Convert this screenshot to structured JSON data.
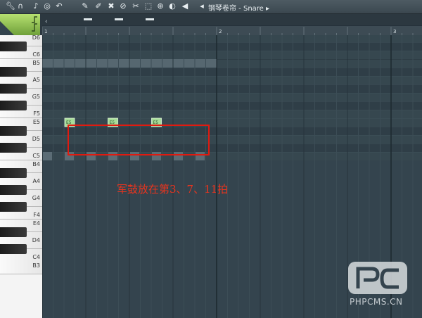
{
  "toolbar": {
    "icons": [
      "wrench-icon",
      "magnet-icon",
      "note-icon",
      "record-icon",
      "undo-icon",
      "pencil-icon",
      "brush-icon",
      "delete-icon",
      "mute-icon",
      "slice-icon",
      "select-icon",
      "zoom-icon",
      "playback-icon",
      "speaker-icon"
    ],
    "title": "钢琴卷帘 - Snare",
    "title_arrow": "▸"
  },
  "ruler": {
    "bar_numbers": [
      "1",
      "2",
      "3"
    ]
  },
  "keyboard": {
    "labels": [
      "D6",
      "C6",
      "B5",
      "A5",
      "G5",
      "F5",
      "E5",
      "D5",
      "C5",
      "B4",
      "A4",
      "G4",
      "F4",
      "E4",
      "D4",
      "C4",
      "B3"
    ]
  },
  "notes": [
    {
      "label": "E5",
      "beat": 3
    },
    {
      "label": "E5",
      "beat": 7
    },
    {
      "label": "E5",
      "beat": 11
    }
  ],
  "annotation": {
    "text": "军鼓放在第3、7、11拍"
  },
  "watermark": {
    "badge": "PC",
    "text": "PHPCMS.CN"
  },
  "colors": {
    "grid_bg": "#34444e",
    "note": "#a6dd98",
    "annotation": "#e11a0f",
    "accent": "#8ec24e"
  }
}
